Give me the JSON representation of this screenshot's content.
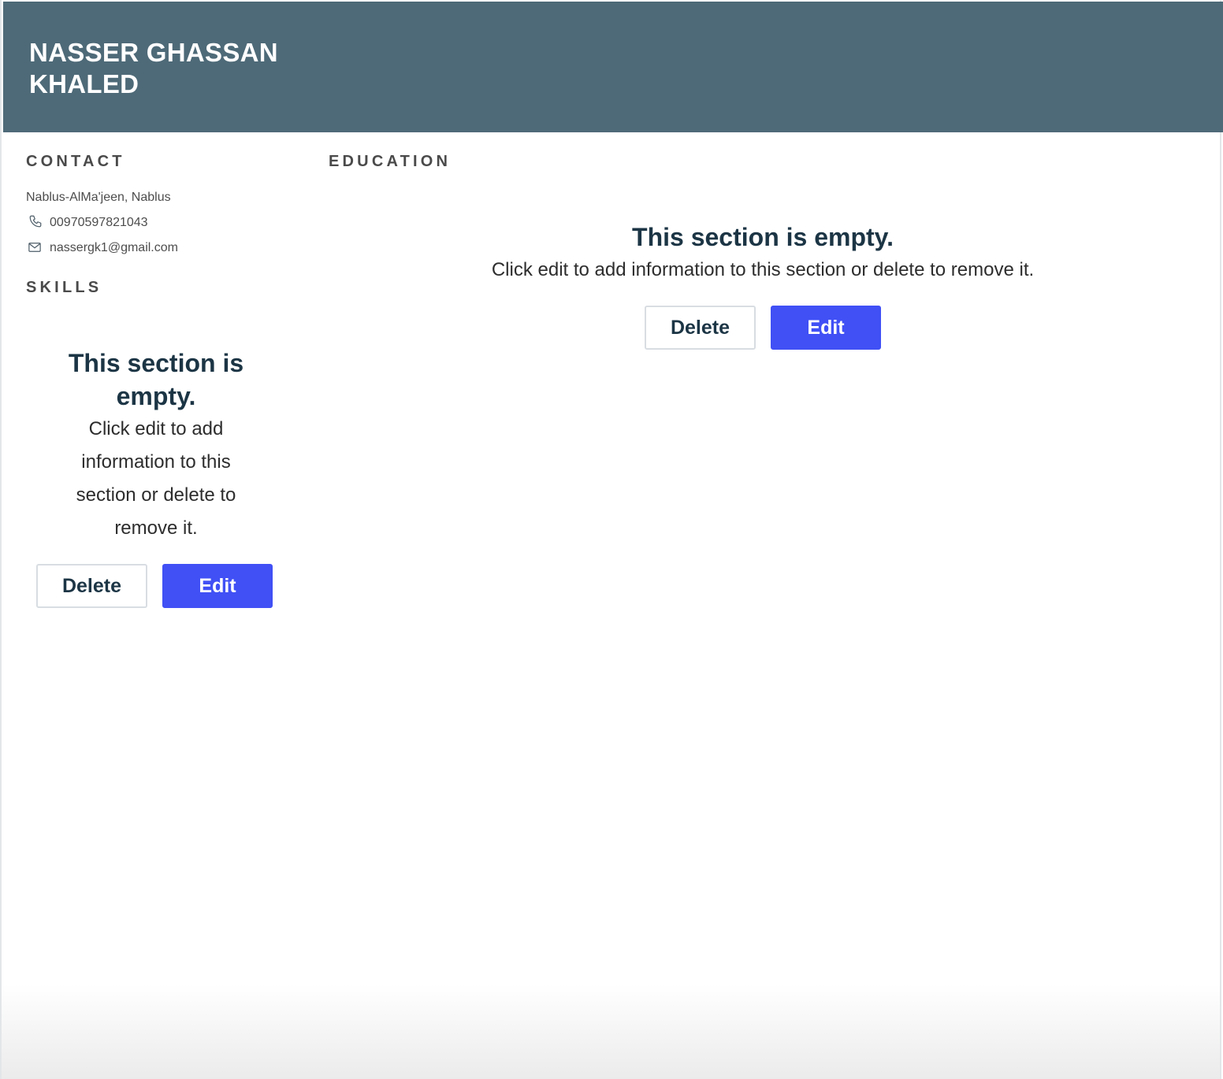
{
  "header": {
    "name_line1": "NASSER GHASSAN",
    "name_line2": "KHALED"
  },
  "contact": {
    "title": "CONTACT",
    "address": "Nablus-AlMa'jeen, Nablus",
    "phone": "00970597821043",
    "email": "nassergk1@gmail.com",
    "phone_icon": "phone-icon",
    "email_icon": "envelope-icon"
  },
  "skills": {
    "title": "SKILLS",
    "empty_title_line1": "This section is",
    "empty_title_line2": "empty.",
    "empty_text_lines": [
      "Click edit to add",
      "information to this",
      "section or delete to",
      "remove it."
    ],
    "delete_label": "Delete",
    "edit_label": "Edit"
  },
  "education": {
    "title": "EDUCATION",
    "empty_title": "This section is empty.",
    "empty_text": "Click edit to add information to this section or delete to remove it.",
    "delete_label": "Delete",
    "edit_label": "Edit"
  },
  "colors": {
    "header_bg": "#4e6a78",
    "edit_button": "#4050f5",
    "title_text": "#1c3545"
  }
}
